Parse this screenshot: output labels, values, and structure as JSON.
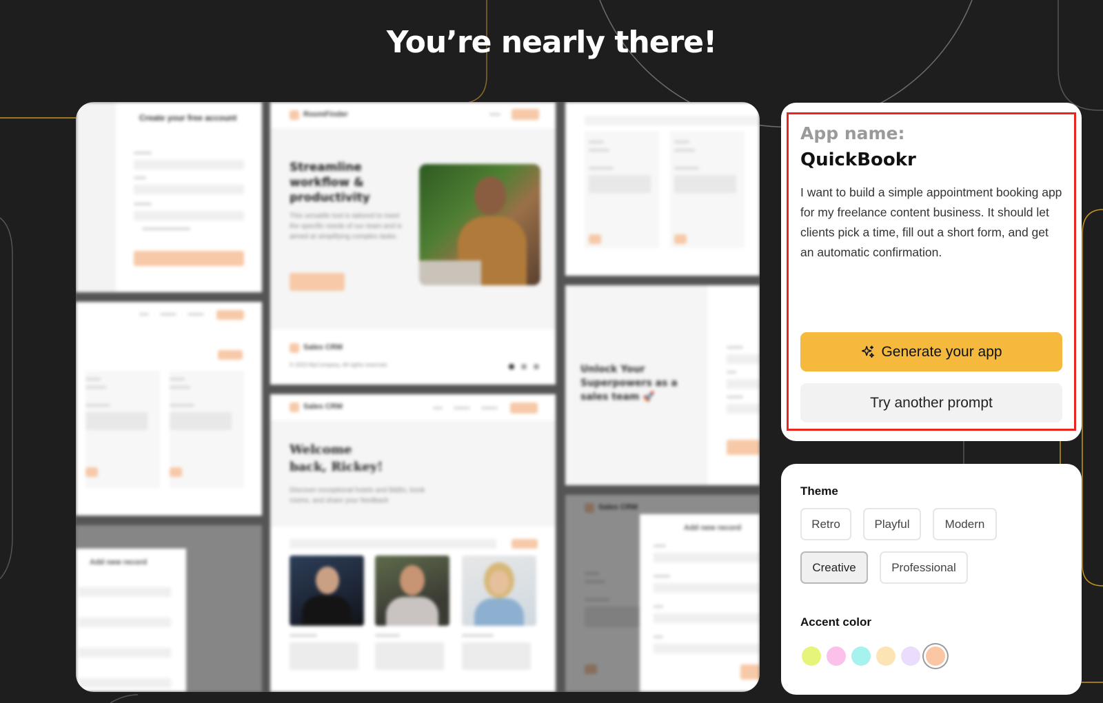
{
  "title": "You’re nearly there!",
  "prompt_card": {
    "app_name_label": "App name:",
    "app_name": "QuickBookr",
    "prompt": "I want to build a simple appointment booking app for my freelance content business. It should let clients pick a time, fill out a short form, and get an automatic confirmation.",
    "generate_label": "Generate your app",
    "try_another_label": "Try another prompt",
    "generate_icon": "sparkles-icon",
    "colors": {
      "generate_bg": "#f4b93d",
      "highlight_border": "#e8251e"
    }
  },
  "theme_card": {
    "theme_label": "Theme",
    "themes": [
      {
        "label": "Retro",
        "selected": false
      },
      {
        "label": "Playful",
        "selected": false
      },
      {
        "label": "Modern",
        "selected": false
      },
      {
        "label": "Creative",
        "selected": true
      },
      {
        "label": "Professional",
        "selected": false
      }
    ],
    "accent_label": "Accent color",
    "accent_colors": [
      {
        "color": "#e6f57a",
        "selected": false
      },
      {
        "color": "#fbc1ea",
        "selected": false
      },
      {
        "color": "#a5f2ef",
        "selected": false
      },
      {
        "color": "#fde4b4",
        "selected": false
      },
      {
        "color": "#eadcfb",
        "selected": false
      },
      {
        "color": "#fbc6a3",
        "selected": true
      }
    ]
  },
  "preview": {
    "signup_title": "Create your free account",
    "roomfinder_logo": "RoomFinder",
    "hero_heading": "Streamline workflow & productivity",
    "hero_text": "This versatile tool is tailored to meet the specific needs of our team and is aimed at simplifying complex tasks.",
    "sales_crm_logo": "Sales CRM",
    "copyright": "© 2023 MyCompany. All rights reserved.",
    "superpowers_heading": "Unlock Your Superpowers as a sales team 🚀",
    "welcome_heading": "Welcome back, Rickey!",
    "welcome_text": "Discover exceptional hotels and B&Bs, book rooms, and share your feedback",
    "add_record_title": "Add new record",
    "accent_color": "#f7c9a8"
  }
}
